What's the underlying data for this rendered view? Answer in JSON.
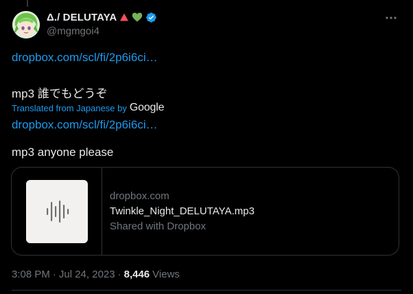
{
  "author": {
    "display_name": "Δ./ DELUTAYA",
    "handle": "@mgmgoi4"
  },
  "tweet": {
    "link1": "dropbox.com/scl/fi/2p6i6ci…",
    "original_text": "mp3 誰でもどうぞ",
    "translated_from": "Translated from Japanese by",
    "translator": "Google",
    "link2": "dropbox.com/scl/fi/2p6i6ci…",
    "translated_text": "mp3 anyone please"
  },
  "card": {
    "domain": "dropbox.com",
    "title": "Twinkle_Night_DELUTAYA.mp3",
    "description": "Shared with Dropbox"
  },
  "meta": {
    "time": "3:08 PM",
    "separator1": "·",
    "date": "Jul 24, 2023",
    "separator2": "·",
    "views_count": "8,446",
    "views_label": "Views"
  },
  "icons": {
    "verified": "verified-badge-icon",
    "more": "more-options-icon",
    "triangle": "red-triangle-emoji",
    "heart": "green-heart-emoji",
    "audio": "audio-waveform-icon"
  },
  "colors": {
    "background": "#000000",
    "link": "#1d9bf0",
    "secondary": "#71767b",
    "primary": "#e7e9ea",
    "border": "#2f3336"
  }
}
